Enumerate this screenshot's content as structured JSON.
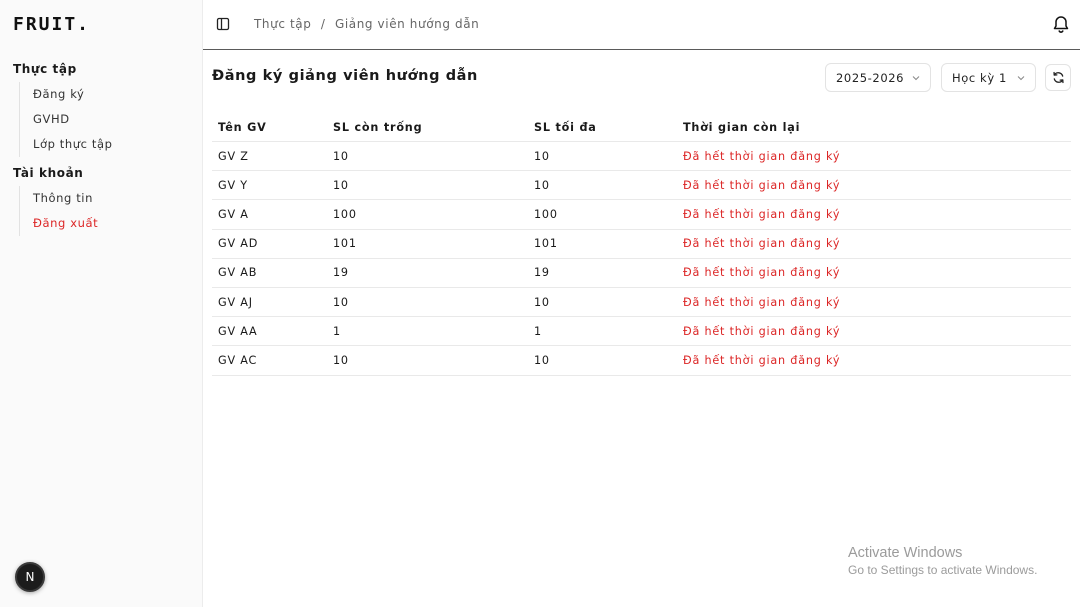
{
  "sidebar": {
    "logo": "FRUIT.",
    "groups": [
      {
        "title": "Thực tập",
        "items": [
          "Đăng ký",
          "GVHD",
          "Lớp thực tập"
        ]
      },
      {
        "title": "Tài khoản",
        "items": [
          "Thông tin",
          "Đăng xuất"
        ]
      }
    ],
    "avatar_letter": "N"
  },
  "header": {
    "breadcrumb": [
      "Thực tập",
      "Giảng viên hướng dẫn"
    ],
    "separator": "/"
  },
  "page": {
    "title": "Đăng ký giảng viên hướng dẫn",
    "year_select": "2025-2026",
    "term_select": "Học kỳ 1"
  },
  "table": {
    "columns": [
      "Tên GV",
      "SL còn trống",
      "SL tối đa",
      "Thời gian còn lại"
    ],
    "rows": [
      [
        "GV Z",
        "10",
        "10",
        "Đã hết thời gian đăng ký"
      ],
      [
        "GV Y",
        "10",
        "10",
        "Đã hết thời gian đăng ký"
      ],
      [
        "GV A",
        "100",
        "100",
        "Đã hết thời gian đăng ký"
      ],
      [
        "GV AD",
        "101",
        "101",
        "Đã hết thời gian đăng ký"
      ],
      [
        "GV AB",
        "19",
        "19",
        "Đã hết thời gian đăng ký"
      ],
      [
        "GV AJ",
        "10",
        "10",
        "Đã hết thời gian đăng ký"
      ],
      [
        "GV AA",
        "1",
        "1",
        "Đã hết thời gian đăng ký"
      ],
      [
        "GV AC",
        "10",
        "10",
        "Đã hết thời gian đăng ký"
      ]
    ]
  },
  "watermark": {
    "line1": "Activate Windows",
    "line2": "Go to Settings to activate Windows."
  },
  "colors": {
    "danger": "#dc2626",
    "text": "#1a1a1a",
    "muted": "#666666"
  },
  "icons": {
    "sidebar_toggle": "sidebar-toggle-icon",
    "bell": "bell-icon",
    "refresh": "refresh-icon",
    "chevron": "chevron-down-icon"
  }
}
